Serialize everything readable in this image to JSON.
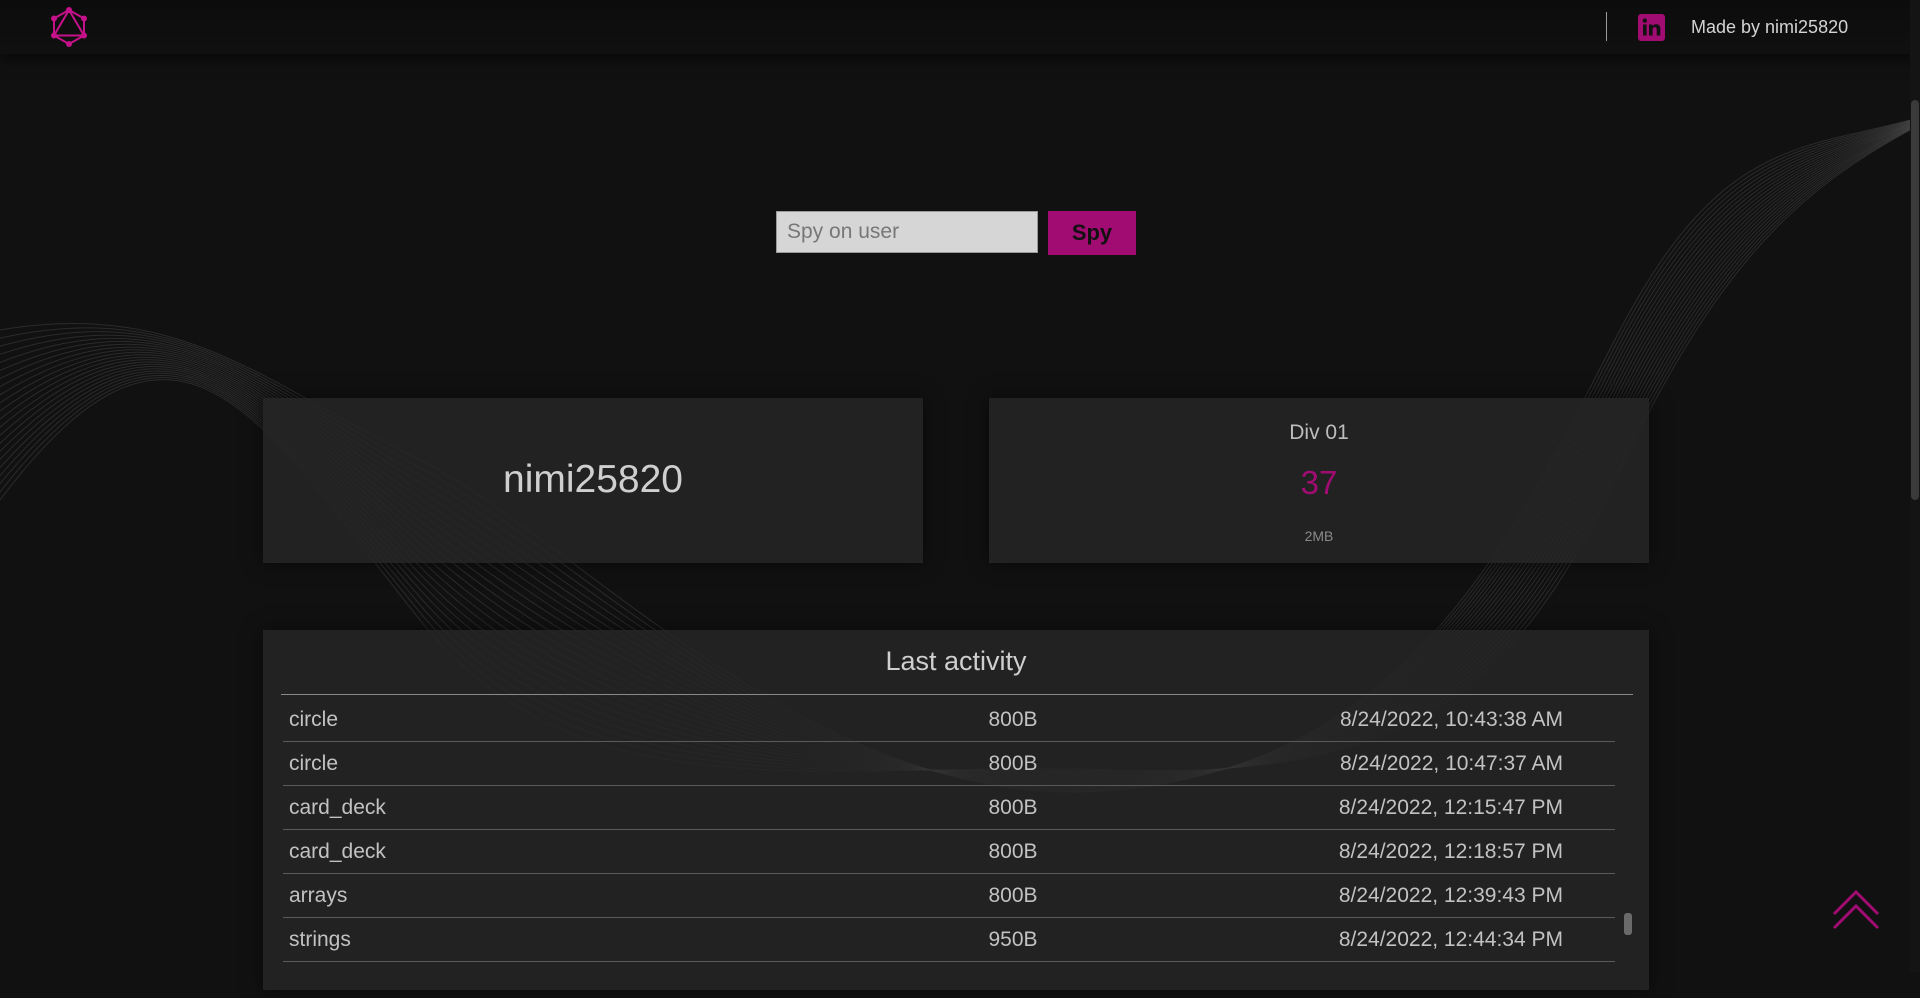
{
  "header": {
    "made_by": "Made by nimi25820",
    "logo_icon": "graphql-icon",
    "social_icon": "linkedin-icon"
  },
  "search": {
    "placeholder": "Spy on user",
    "value": "",
    "button_label": "Spy"
  },
  "profile": {
    "username": "nimi25820"
  },
  "division": {
    "title": "Div 01",
    "number": "37",
    "size": "2MB"
  },
  "activity": {
    "title": "Last activity",
    "rows": [
      {
        "name": "circle",
        "size": "800B",
        "date": "8/24/2022, 10:43:38 AM"
      },
      {
        "name": "circle",
        "size": "800B",
        "date": "8/24/2022, 10:47:37 AM"
      },
      {
        "name": "card_deck",
        "size": "800B",
        "date": "8/24/2022, 12:15:47 PM"
      },
      {
        "name": "card_deck",
        "size": "800B",
        "date": "8/24/2022, 12:18:57 PM"
      },
      {
        "name": "arrays",
        "size": "800B",
        "date": "8/24/2022, 12:39:43 PM"
      },
      {
        "name": "strings",
        "size": "950B",
        "date": "8/24/2022, 12:44:34 PM"
      }
    ]
  },
  "colors": {
    "accent": "#a10c72",
    "background": "#111112",
    "card": "#262626"
  }
}
